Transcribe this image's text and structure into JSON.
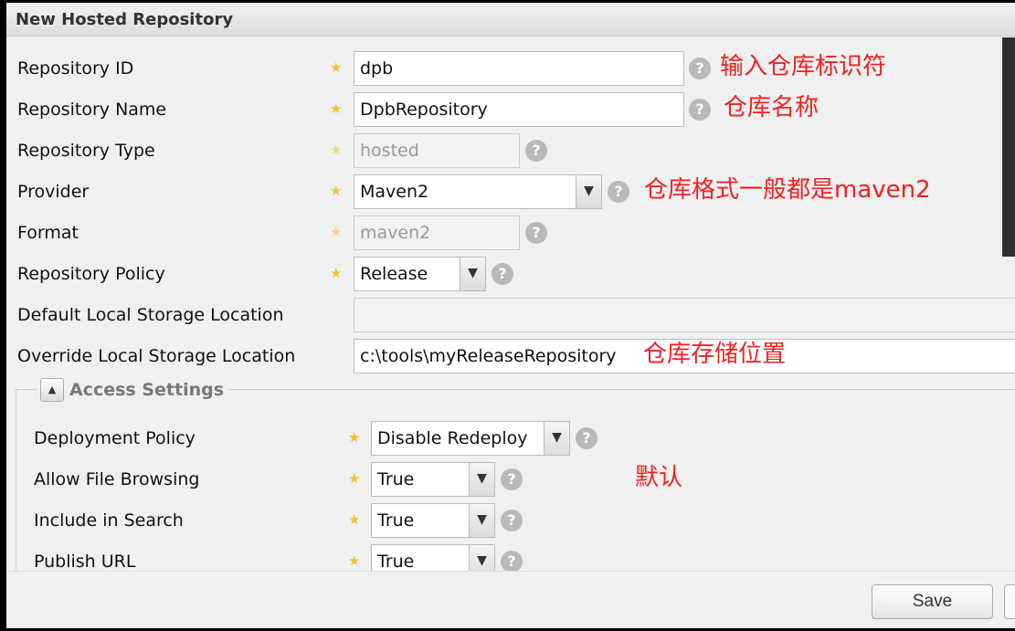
{
  "title": "New Hosted Repository",
  "fields": [
    {
      "label": "Repository ID",
      "value": "dpb",
      "required": true,
      "note": "输入仓库标识符"
    },
    {
      "label": "Repository Name",
      "value": "DpbRepository",
      "required": true,
      "note": "仓库名称"
    },
    {
      "label": "Repository Type",
      "value": "hosted",
      "required": true,
      "disabled": true
    },
    {
      "label": "Provider",
      "value": "Maven2",
      "required": true,
      "note": "仓库格式一般都是maven2"
    },
    {
      "label": "Format",
      "value": "maven2",
      "required": true,
      "disabled": true
    },
    {
      "label": "Repository Policy",
      "value": "Release",
      "required": true
    },
    {
      "label": "Default Local Storage Location",
      "value": ""
    },
    {
      "label": "Override Local Storage Location",
      "value": "c:\\tools\\myReleaseRepository",
      "note": "仓库存储位置"
    }
  ],
  "access": {
    "title": "Access Settings",
    "note": "默认",
    "fields": [
      {
        "label": "Deployment Policy",
        "value": "Disable Redeploy"
      },
      {
        "label": "Allow File Browsing",
        "value": "True"
      },
      {
        "label": "Include in Search",
        "value": "True"
      },
      {
        "label": "Publish URL",
        "value": "True"
      }
    ]
  },
  "footer": {
    "save": "Save"
  },
  "colors": {
    "note": "#ee2222",
    "star": "#f2c230"
  }
}
